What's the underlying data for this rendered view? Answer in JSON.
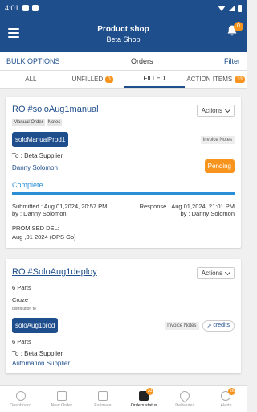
{
  "status_bar": {
    "time": "4:01"
  },
  "app_bar": {
    "title": "Product shop",
    "subtitle": "Beta Shop",
    "notification_count": "0"
  },
  "sub_bar": {
    "bulk": "BULK OPTIONS",
    "center": "Orders",
    "filter": "Filter"
  },
  "tabs": [
    {
      "label": "ALL",
      "count": ""
    },
    {
      "label": "UNFILLED",
      "count": "0"
    },
    {
      "label": "FILLED",
      "count": ""
    },
    {
      "label": "ACTION ITEMS",
      "count": "33"
    }
  ],
  "cards": [
    {
      "title": "RO #soloAug1manual",
      "actions": "Actions",
      "tags": [
        "Manual Order",
        "Notes"
      ],
      "product": "soloManualProd1",
      "invoice": "Invoice Notes",
      "to": "To : Beta Supplier",
      "supplier": "Danny Solomon",
      "status": "Pending",
      "stage": "Complete",
      "progress_fraction": 1.0,
      "submitted": "Submitted : Aug 01,2024, 20:57 PM",
      "submitted_by": "by : Danny Solomon",
      "response": "Response : Aug 01,2024, 21:01 PM",
      "response_by": "by : Danny Solomon",
      "promised_label": "PROMISED DEL:",
      "promised_value": "Aug ,01 2024 (OPS Go)"
    },
    {
      "title": "RO #SoloAug1deploy",
      "actions": "Actions",
      "parts": "6 Parts",
      "model": "Cruze",
      "tiny": "distribution to",
      "product": "soloAug1prod",
      "invoice": "Invoice Notes",
      "credits": "credits",
      "parts2": "6 Parts",
      "to": "To : Beta Supplier",
      "supplier": "Automation Supplier"
    }
  ],
  "bottom_nav": [
    {
      "label": "Dashboard",
      "badge": ""
    },
    {
      "label": "New Order",
      "badge": ""
    },
    {
      "label": "Estimate",
      "badge": ""
    },
    {
      "label": "Orders status",
      "badge": "33"
    },
    {
      "label": "Deliveries",
      "badge": ""
    },
    {
      "label": "Alerts",
      "badge": "26"
    }
  ],
  "colors": {
    "primary": "#1f4e8c",
    "accent": "#f7941d",
    "progress": "#2a8fd6"
  }
}
